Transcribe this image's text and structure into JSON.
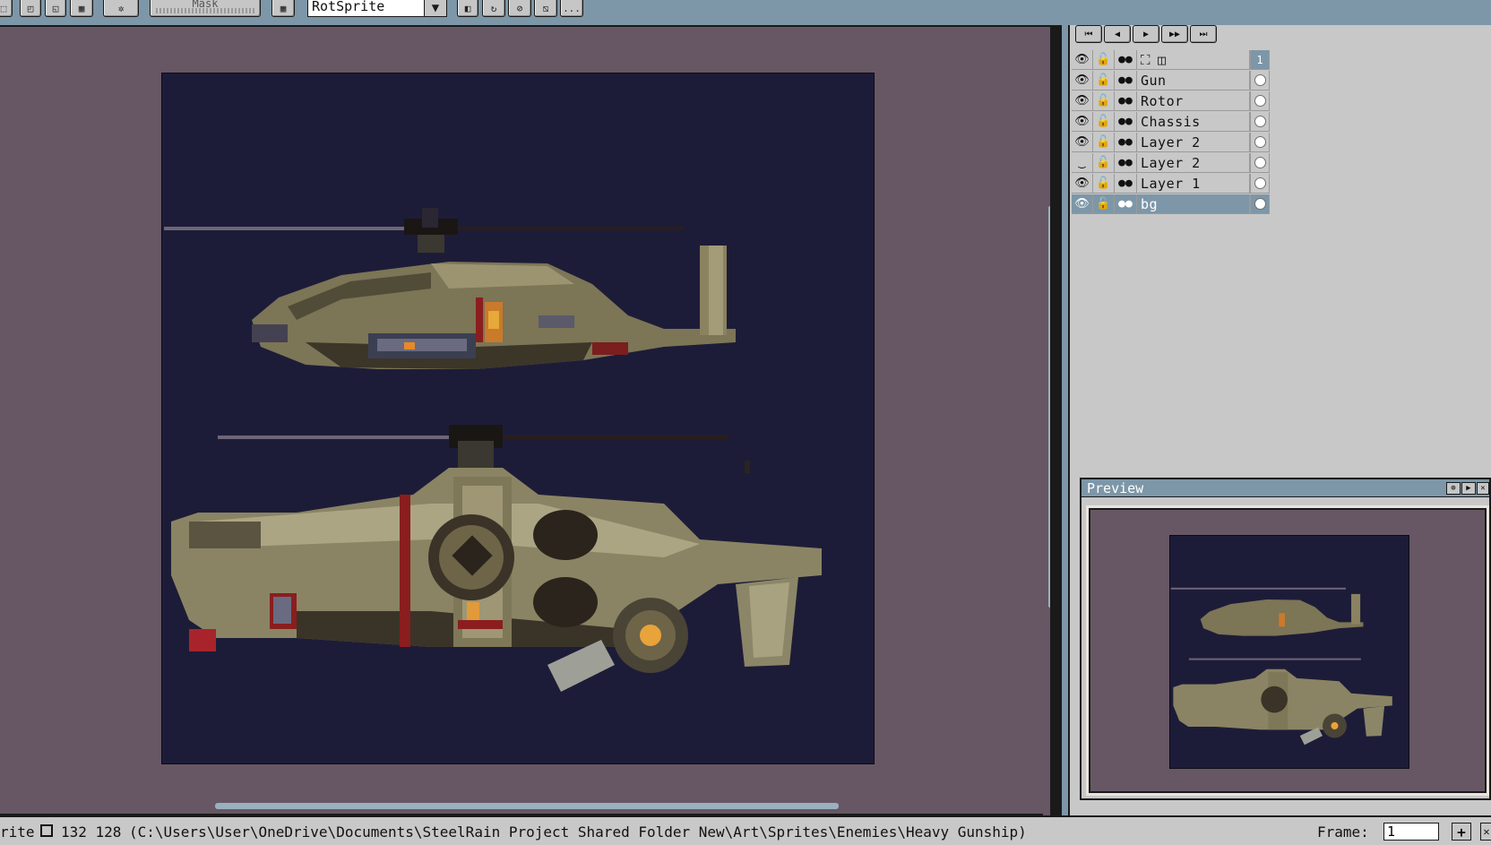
{
  "toolbar": {
    "buttons": [
      {
        "name": "select-mode-1-icon",
        "glyph": "⬚"
      },
      {
        "name": "select-mode-2-icon",
        "glyph": "◰"
      },
      {
        "name": "select-mode-3-icon",
        "glyph": "◱"
      },
      {
        "name": "select-mode-4-icon",
        "glyph": "▦"
      },
      {
        "name": "pivot-icon",
        "glyph": "✲"
      }
    ],
    "mask_label": "Mask",
    "grid_glyph": "▦",
    "rotation_algorithm": "RotSprite",
    "transform_buttons": [
      {
        "name": "flip-icon",
        "glyph": "◧"
      },
      {
        "name": "rotate-icon",
        "glyph": "↻"
      },
      {
        "name": "skew-icon",
        "glyph": "⊘"
      },
      {
        "name": "distort-icon",
        "glyph": "⧅"
      }
    ],
    "more_label": "..."
  },
  "animation_controls": [
    {
      "name": "first-frame-button",
      "glyph": "⏮"
    },
    {
      "name": "previous-frame-button",
      "glyph": "◀"
    },
    {
      "name": "play-button",
      "glyph": "▶"
    },
    {
      "name": "next-frame-button",
      "glyph": "▶▶"
    },
    {
      "name": "last-frame-button",
      "glyph": "⏭"
    }
  ],
  "layers_header": {
    "frame_number": "1"
  },
  "layers": [
    {
      "name": "Gun",
      "visible": true,
      "selected": false
    },
    {
      "name": "Rotor",
      "visible": true,
      "selected": false
    },
    {
      "name": "Chassis",
      "visible": true,
      "selected": false
    },
    {
      "name": "Layer 2",
      "visible": true,
      "selected": false
    },
    {
      "name": "Layer 2",
      "visible": false,
      "selected": false
    },
    {
      "name": "Layer 1",
      "visible": true,
      "selected": false
    },
    {
      "name": "bg",
      "visible": true,
      "selected": true
    }
  ],
  "preview": {
    "title": "Preview"
  },
  "status": {
    "left_text": "rite",
    "sprite_size": "132 128",
    "file_path": "(C:\\Users\\User\\OneDrive\\Documents\\SteelRain Project Shared Folder New\\Art\\Sprites\\Enemies\\Heavy Gunship)",
    "frame_label": "Frame:",
    "frame_value": "1",
    "add_frame_label": "+"
  },
  "colors": {
    "chrome_blue": "#7d97a8",
    "panel_gray": "#c8c8c8",
    "canvas_bg": "#675764",
    "sprite_bg": "#1d1c38"
  }
}
